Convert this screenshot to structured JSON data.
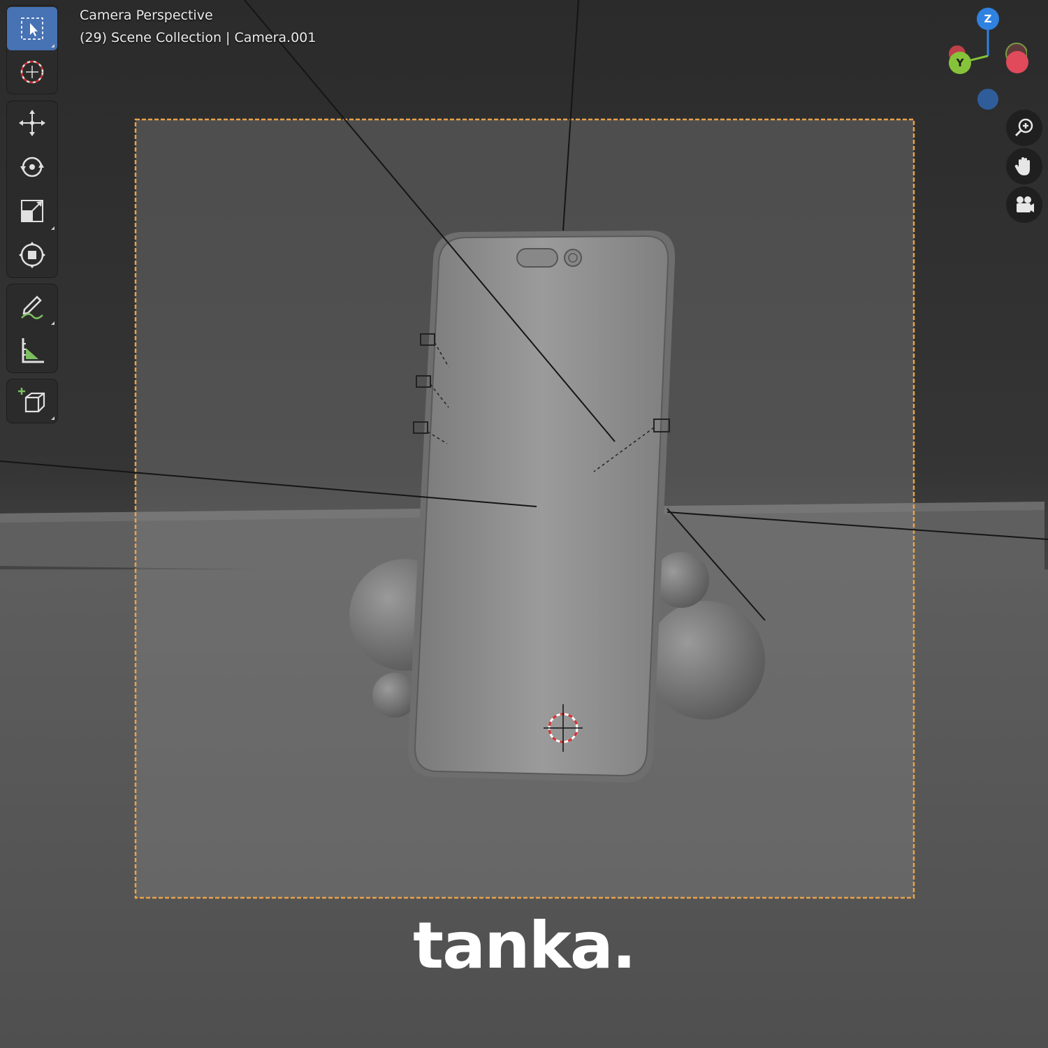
{
  "viewport": {
    "view_name": "Camera Perspective",
    "scene_info": "(29) Scene Collection | Camera.001"
  },
  "toolbar": {
    "tools": [
      {
        "name": "Select Box",
        "icon": "select-box-icon",
        "active": true
      },
      {
        "name": "Cursor",
        "icon": "cursor-icon",
        "active": false
      },
      {
        "name": "Move",
        "icon": "move-icon",
        "active": false
      },
      {
        "name": "Rotate",
        "icon": "rotate-icon",
        "active": false
      },
      {
        "name": "Scale",
        "icon": "scale-icon",
        "active": false
      },
      {
        "name": "Transform",
        "icon": "transform-icon",
        "active": false
      },
      {
        "name": "Annotate",
        "icon": "annotate-icon",
        "active": false
      },
      {
        "name": "Measure",
        "icon": "measure-icon",
        "active": false
      },
      {
        "name": "Add Cube",
        "icon": "add-cube-icon",
        "active": false
      }
    ]
  },
  "gizmo": {
    "z_label": "Z",
    "y_label": "Y",
    "x_color": "#e04a5a",
    "y_color": "#86c33a",
    "z_color": "#2f82e0",
    "neg_z_color": "#2f5d9a"
  },
  "nav_buttons": [
    {
      "icon": "zoom-icon"
    },
    {
      "icon": "hand-pan-icon"
    },
    {
      "icon": "camera-view-icon"
    }
  ],
  "colors": {
    "active_tool": "#4772b3",
    "camera_frame": "#e8a24a",
    "background_top": "#2a2a2a",
    "floor": "#6f6f6f"
  },
  "watermark": {
    "text": "tanka."
  }
}
